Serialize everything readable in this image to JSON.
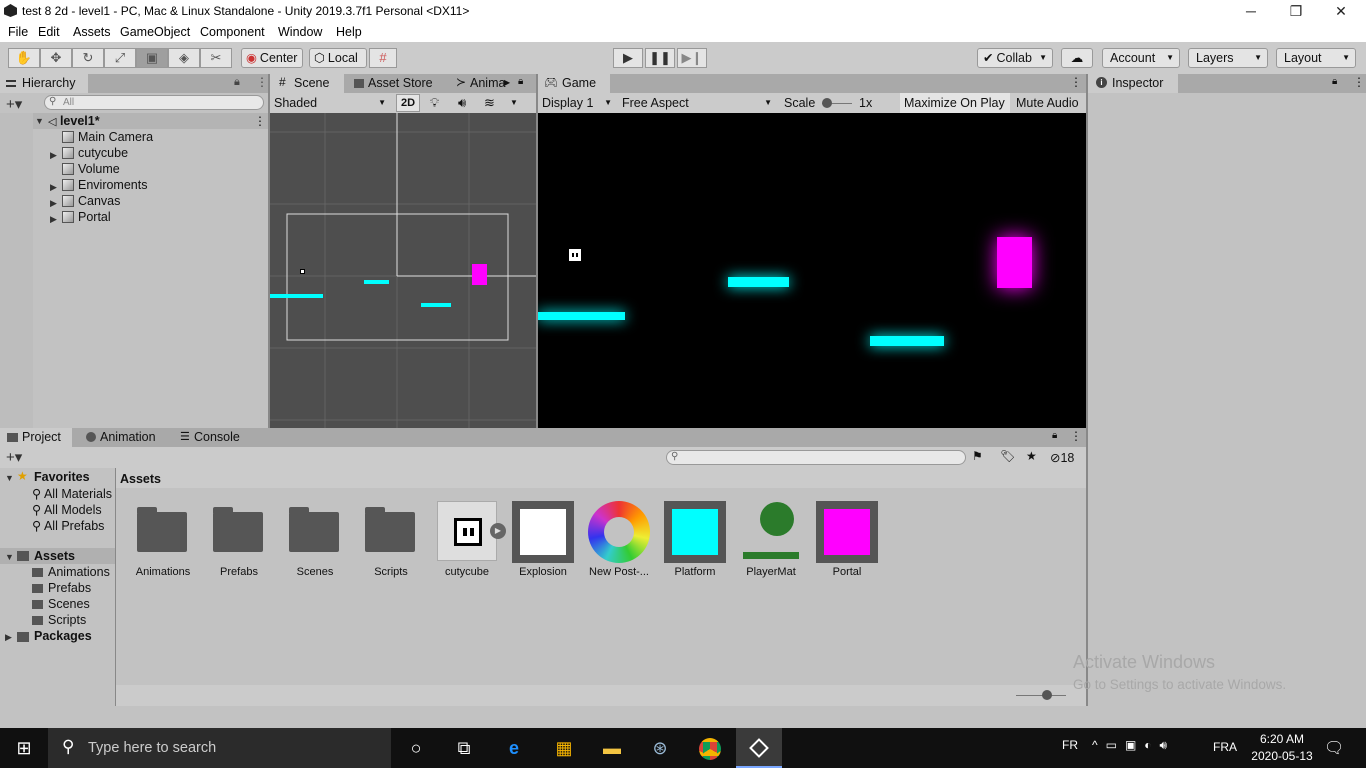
{
  "window": {
    "title": "test 8 2d - level1 - PC, Mac & Linux Standalone - Unity 2019.3.7f1 Personal <DX11>",
    "minimize": "─",
    "maximize": "❐",
    "close": "✕"
  },
  "menu": [
    "File",
    "Edit",
    "Assets",
    "GameObject",
    "Component",
    "Window",
    "Help"
  ],
  "toolbar": {
    "center": "Center",
    "local": "Local",
    "collab": "Collab",
    "account": "Account",
    "layers": "Layers",
    "layout": "Layout"
  },
  "hierarchy": {
    "tab": "Hierarchy",
    "search_placeholder": "All",
    "scene": "level1*",
    "items": [
      {
        "name": "Main Camera",
        "expandable": false
      },
      {
        "name": "cutycube",
        "expandable": true
      },
      {
        "name": "Volume",
        "expandable": false
      },
      {
        "name": "Enviroments",
        "expandable": true
      },
      {
        "name": "Canvas",
        "expandable": true
      },
      {
        "name": "Portal",
        "expandable": true
      }
    ]
  },
  "scene": {
    "tabs": [
      "Scene",
      "Asset Store",
      "Anima"
    ],
    "shading": "Shaded",
    "mode_2d": "2D"
  },
  "game": {
    "tab": "Game",
    "display": "Display 1",
    "aspect": "Free Aspect",
    "scale_label": "Scale",
    "scale_value": "1x",
    "maximize": "Maximize On Play",
    "mute": "Mute Audio"
  },
  "inspector": {
    "tab": "Inspector"
  },
  "project": {
    "tabs": [
      "Project",
      "Animation",
      "Console"
    ],
    "hidden_count": "18",
    "favorites_label": "Favorites",
    "favorites": [
      "All Materials",
      "All Models",
      "All Prefabs"
    ],
    "assets_label": "Assets",
    "asset_folders": [
      "Animations",
      "Prefabs",
      "Scenes",
      "Scripts"
    ],
    "packages_label": "Packages",
    "breadcrumb": "Assets",
    "assets": [
      {
        "name": "Animations",
        "kind": "folder"
      },
      {
        "name": "Prefabs",
        "kind": "folder"
      },
      {
        "name": "Scenes",
        "kind": "folder"
      },
      {
        "name": "Scripts",
        "kind": "folder"
      },
      {
        "name": "cutycube",
        "kind": "prefab"
      },
      {
        "name": "Explosion",
        "kind": "material",
        "color": "#ffffff"
      },
      {
        "name": "New Post-...",
        "kind": "postprocess"
      },
      {
        "name": "Platform",
        "kind": "material",
        "color": "#00ffff"
      },
      {
        "name": "PlayerMat",
        "kind": "physics"
      },
      {
        "name": "Portal",
        "kind": "material",
        "color": "#ff00ff"
      }
    ]
  },
  "watermark": {
    "line1": "Activate Windows",
    "line2": "Go to Settings to activate Windows."
  },
  "taskbar": {
    "search_placeholder": "Type here to search",
    "lang": "FR",
    "kb": "FRA",
    "time": "6:20 AM",
    "date": "2020-05-13"
  },
  "colors": {
    "cyan": "#00ffff",
    "magenta": "#ff00ff"
  }
}
